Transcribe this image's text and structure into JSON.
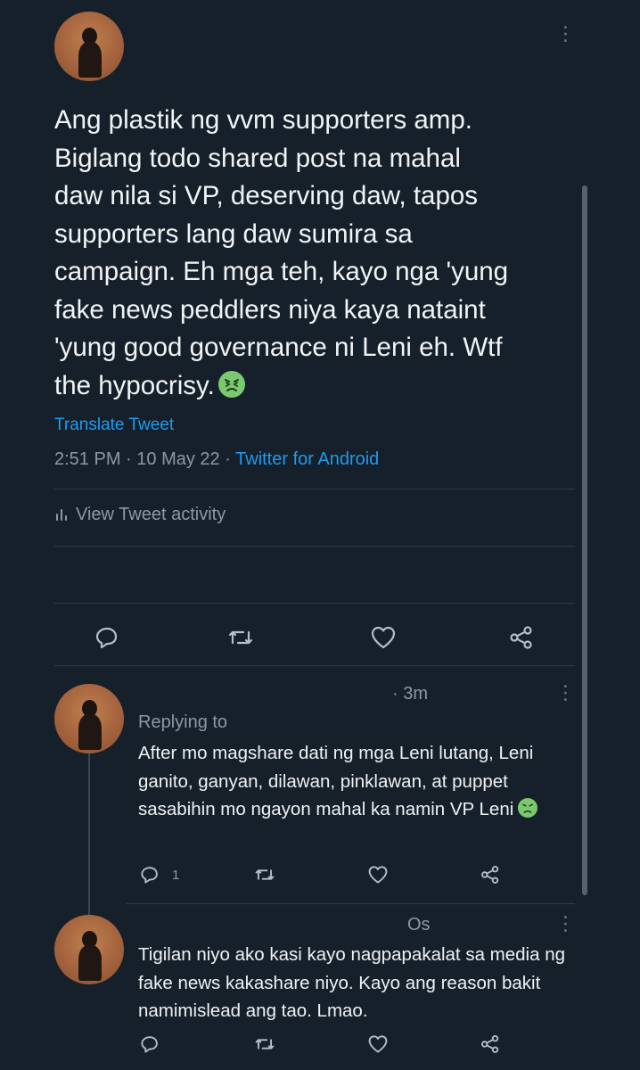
{
  "main_tweet": {
    "text": "Ang plastik ng vvm supporters amp.\nBiglang todo shared post na mahal\ndaw nila si VP, deserving daw, tapos\nsupporters lang daw sumira sa\ncampaign. Eh mga teh, kayo nga 'yung\nfake news peddlers niya kaya nataint\n'yung good governance ni Leni eh. Wtf\nthe hypocrisy.",
    "emoji": "nauseated-face",
    "translate_label": "Translate Tweet",
    "time": "2:51 PM",
    "date": "10 May 22",
    "source": "Twitter for Android",
    "separator": "·",
    "activity_label": "View Tweet activity"
  },
  "reply1": {
    "time": "· 3m",
    "replying_to_label": "Replying to",
    "text": "After mo magshare dati ng mga Leni lutang, Leni ganito, ganyan, dilawan, pinklawan, at puppet sasabihin mo ngayon mahal ka namin VP Leni",
    "emoji": "nauseated-face",
    "reply_count": "1"
  },
  "reply2": {
    "time": "Os",
    "text": "Tigilan niyo ako kasi kayo nagpapakalat sa media ng fake news kakashare niyo. Kayo ang reason bakit namimislead ang tao. Lmao."
  },
  "colors": {
    "background": "#16202b",
    "link": "#1d9bf0",
    "muted": "#8b98a5",
    "divider": "#2f3b47"
  }
}
